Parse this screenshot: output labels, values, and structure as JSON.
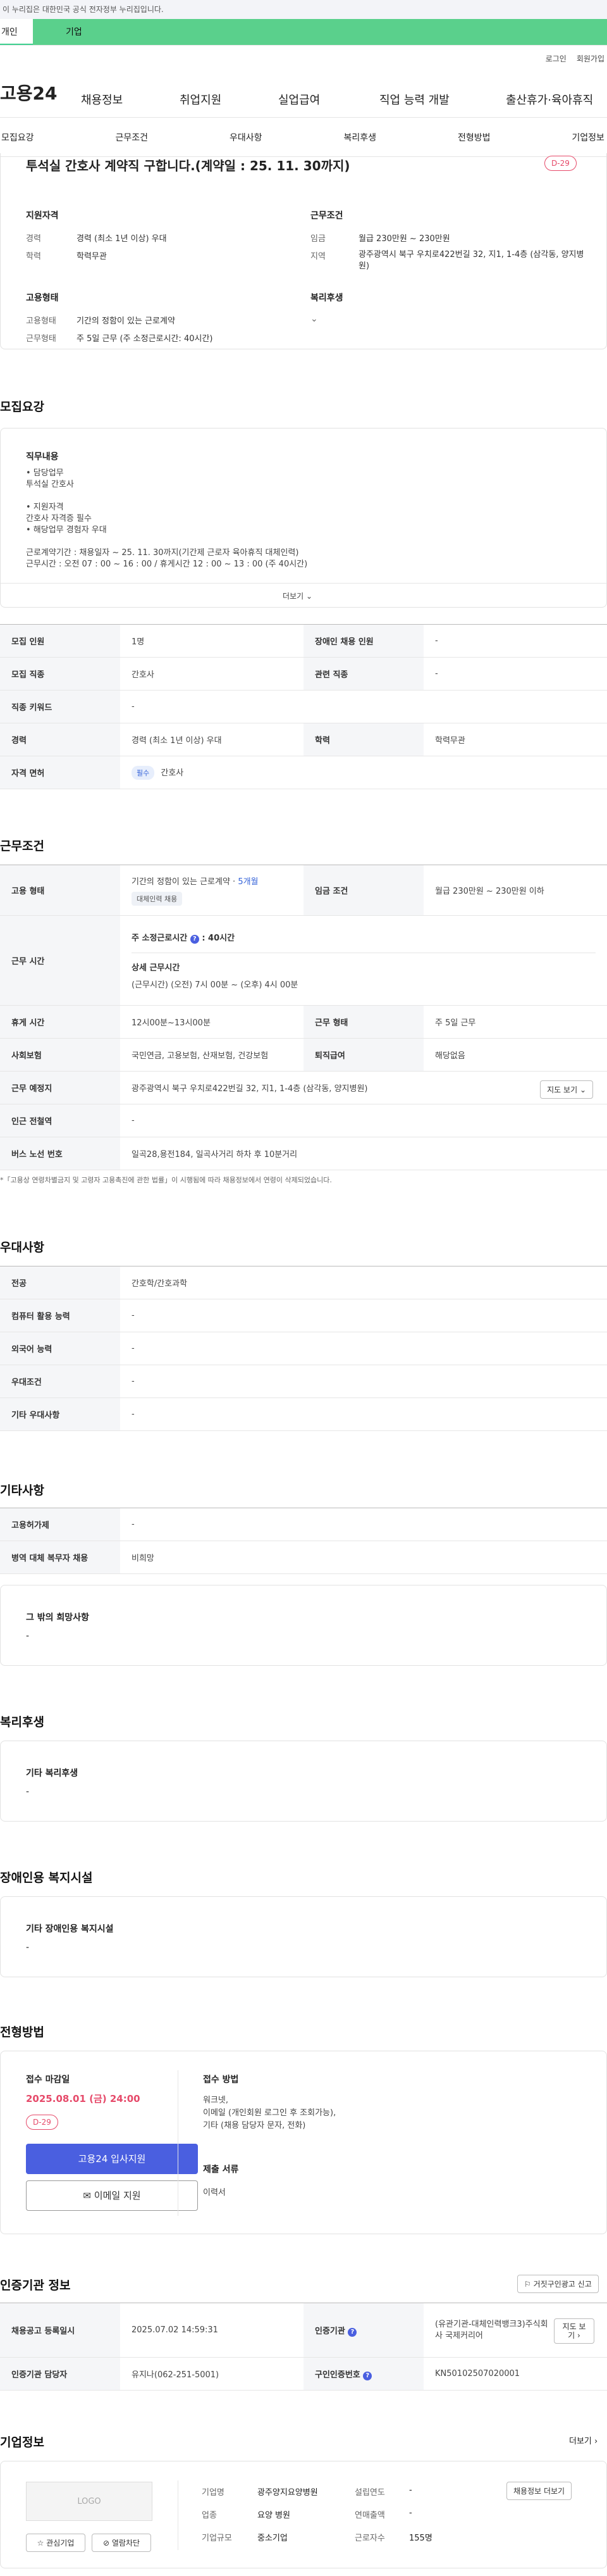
{
  "gov_banner": "이 누리집은 대한민국 공식 전자정부 누리집입니다.",
  "top_tabs": [
    "개인",
    "기업"
  ],
  "util": [
    "로그인",
    "회원가입"
  ],
  "logo": "고용24",
  "gnb": [
    "채용정보",
    "취업지원",
    "실업급여",
    "직업 능력 개발",
    "출산휴가·육아휴직"
  ],
  "subnav": [
    "모집요강",
    "근무조건",
    "우대사항",
    "복리후생",
    "전형방법",
    "기업정보"
  ],
  "summary": {
    "title": "투석실 간호사 계약직 구합니다.(계약일 : 25. 11. 30까지)",
    "dday": "D-29",
    "qual_title": "지원자격",
    "career_k": "경력",
    "career_v": "경력 (최소 1년 이상) 우대",
    "edu_k": "학력",
    "edu_v": "학력무관",
    "work_title": "근무조건",
    "wage_k": "임금",
    "wage_v": "월급 230만원 ~ 230만원",
    "region_k": "지역",
    "region_v": "광주광역시 북구 우치로422번길 32, 지1, 1-4층 (삼각동, 양지병원)",
    "emp_title": "고용형태",
    "etype_k": "고용형태",
    "etype_v": "기간의 정함이 있는 근로계약",
    "hours_k": "근무형태",
    "hours_v": "주 5일 근무 (주 소정근로시간: 40시간)",
    "welfare_title": "복리후생"
  },
  "recruit": {
    "title": "모집요강",
    "duty_title": "직무내용",
    "duty_lines": [
      "• 담당업무",
      "투석실 간호사",
      "",
      "• 지원자격",
      "간호사 자격증 필수",
      "• 해당업무 경험자 우대",
      "",
      "근로계약기간 : 채용일자 ~ 25. 11. 30까지(기간제 근로자 육아휴직 대체인력)",
      "근무시간 : 오전 07 : 00 ~ 16 : 00 / 휴게시간 12 : 00 ~ 13 : 00 (주 40시간)"
    ],
    "more": "더보기",
    "rows": [
      {
        "k1": "모집 인원",
        "v1": "1명",
        "k2": "장애인 채용 인원",
        "v2": "-"
      },
      {
        "k1": "모집 직종",
        "v1": "간호사",
        "k2": "관련 직종",
        "v2": "-"
      },
      {
        "k1": "직종 키워드",
        "v1": "-"
      },
      {
        "k1": "경력",
        "v1": "경력 (최소 1년 이상) 우대",
        "k2": "학력",
        "v2": "학력무관"
      },
      {
        "k1": "자격 면허",
        "badge": "필수",
        "v1": "간호사"
      }
    ]
  },
  "work": {
    "title": "근무조건",
    "etype_k": "고용 형태",
    "etype_v": "기간의 정함이 있는 근로계약 · ",
    "etype_months": "5개월",
    "etype_tag": "대체인력 채용",
    "wage_k": "임금 조건",
    "wage_v": "월급 230만원 ~ 230만원 이하",
    "time_k": "근무 시간",
    "time_week": "주 소정근로시간",
    "time_week_v": ": 40시간",
    "time_detail_t": "상세 근무시간",
    "time_detail_v": "(근무시간) (오전) 7시 00분 ~ (오후) 4시 00분",
    "rest_k": "휴게 시간",
    "rest_v": "12시00분~13시00분",
    "form_k": "근무 형태",
    "form_v": "주 5일 근무",
    "ins_k": "사회보험",
    "ins_v": "국민연금, 고용보험, 산재보험, 건강보험",
    "ret_k": "퇴직급여",
    "ret_v": "해당없음",
    "place_k": "근무 예정지",
    "place_v": "광주광역시 북구 우치로422번길 32, 지1, 1-4층 (삼각동, 양지병원)",
    "map_btn": "지도 보기",
    "subway_k": "인근 전철역",
    "subway_v": "-",
    "bus_k": "버스 노선 번호",
    "bus_v": "일곡28,용전184, 일곡사거리 하차 후 10분거리",
    "notice": "*「고용상 연령차별금지 및 고령자 고용촉진에 관한 법률」이 시행됨에 따라 채용정보에서 연령이 삭제되었습니다."
  },
  "pref": {
    "title": "우대사항",
    "rows": [
      {
        "k": "전공",
        "v": "간호학/간호과학"
      },
      {
        "k": "컴퓨터 활용 능력",
        "v": "-"
      },
      {
        "k": "외국어 능력",
        "v": "-"
      },
      {
        "k": "우대조건",
        "v": "-"
      },
      {
        "k": "기타 우대사항",
        "v": "-"
      }
    ]
  },
  "etc": {
    "title": "기타사항",
    "rows": [
      {
        "k": "고용허가제",
        "v": "-"
      },
      {
        "k": "병역 대체 복무자 채용",
        "v": "비희망"
      }
    ],
    "wish_title": "그 밖의 희망사항",
    "wish_v": "-"
  },
  "welfare": {
    "title": "복리후생",
    "sub": "기타 복리후생",
    "v": "-"
  },
  "disability": {
    "title": "장애인용 복지시설",
    "sub": "기타 장애인용 복지시설",
    "v": "-"
  },
  "process": {
    "title": "전형방법",
    "deadline_t": "접수 마감일",
    "deadline_v": "2025.08.01 (금) 24:00",
    "dday": "D-29",
    "apply_btn": "고용24 입사지원",
    "email_btn": "이메일 지원",
    "method_t": "접수 방법",
    "method_lines": [
      "워크넷,",
      "이메일 (개인회원 로그인 후 조회가능),",
      "기타 (채용 담당자 문자, 전화)"
    ],
    "docs_t": "제출 서류",
    "docs_v": "이력서"
  },
  "cert": {
    "title": "인증기관 정보",
    "report_btn": "거짓구인광고 신고",
    "reg_k": "채용공고 등록일시",
    "reg_v": "2025.07.02 14:59:31",
    "org_k": "인증기관",
    "org_v": "(유관기관-대체인력뱅크3)주식회사 국제커리어",
    "org_btn": "지도 보기",
    "mgr_k": "인증기관 담당자",
    "mgr_v": "유지나(062-251-5001)",
    "no_k": "구인인증번호",
    "no_v": "KN50102507020001"
  },
  "company": {
    "title": "기업정보",
    "more": "더보기",
    "logo_alt": "LOGO",
    "fav_btn": "관심기업",
    "block_btn": "열람차단",
    "name_k": "기업명",
    "name_v": "광주양지요양병원",
    "est_k": "설립연도",
    "est_v": "-",
    "ind_k": "업종",
    "ind_v": "요양 병원",
    "sales_k": "연매출액",
    "sales_v": "-",
    "size_k": "기업규모",
    "size_v": "중소기업",
    "staff_k": "근로자수",
    "staff_v": "155명",
    "jobs_btn": "채용정보 더보기"
  },
  "colors": {
    "accent": "#3ccf8e",
    "primary": "#4a5fe0",
    "danger": "#e64a6a"
  }
}
